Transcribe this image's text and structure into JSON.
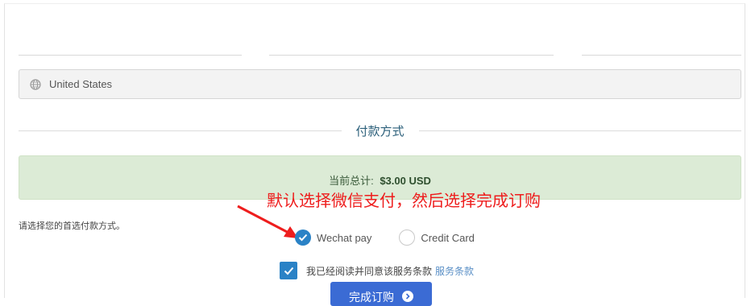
{
  "country": {
    "value": "United States",
    "icon": "globe-icon"
  },
  "payment_section": {
    "heading": "付款方式"
  },
  "total": {
    "label": "当前总计:",
    "amount": "$3.00 USD"
  },
  "annotation": {
    "text": "默认选择微信支付，然后选择完成订购"
  },
  "payment": {
    "prompt": "请选择您的首选付款方式。",
    "options": [
      {
        "label": "Wechat pay",
        "selected": true
      },
      {
        "label": "Credit Card",
        "selected": false
      }
    ]
  },
  "tos": {
    "text": "我已经阅读并同意该服务条款",
    "link": "服务条款",
    "checked": true
  },
  "submit": {
    "label": "完成订购"
  },
  "colors": {
    "accent": "#2a82c6",
    "button": "#3b6bd4",
    "success_bg": "#dcebd6",
    "annotation": "#ee1d1d"
  }
}
